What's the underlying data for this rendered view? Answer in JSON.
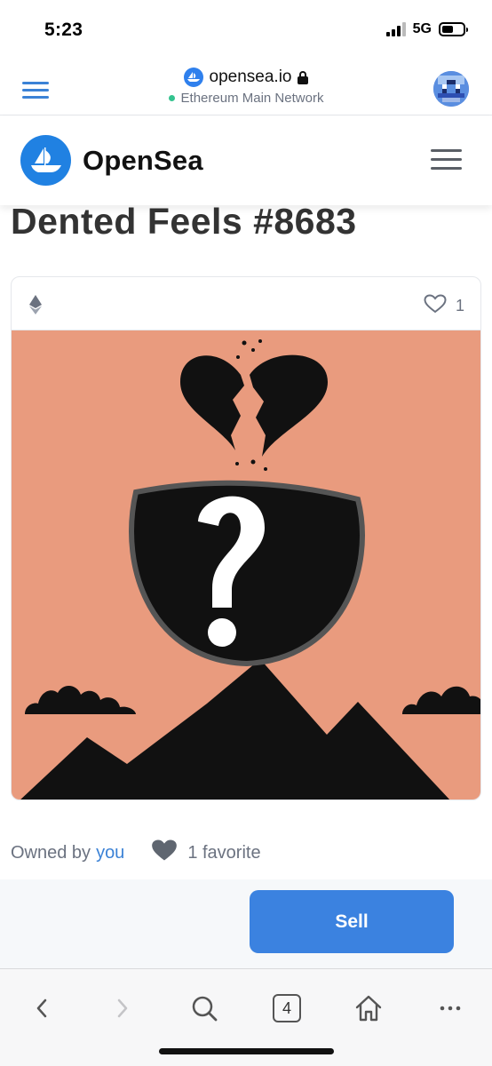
{
  "status": {
    "time": "5:23",
    "network": "5G"
  },
  "browser": {
    "url": "opensea.io",
    "network_label": "Ethereum Main Network"
  },
  "site": {
    "brand": "OpenSea"
  },
  "item": {
    "title": "Dented Feels #8683",
    "favorite_count": "1",
    "owned_by_label": "Owned by",
    "owner": "you",
    "favorites_label": "1 favorite"
  },
  "actions": {
    "sell_label": "Sell"
  },
  "toolbar": {
    "tab_count": "4",
    "icons": [
      "chevron-left-icon",
      "chevron-right-icon",
      "search-icon",
      "tabs-icon",
      "home-icon",
      "more-icon"
    ]
  },
  "colors": {
    "brand_blue": "#2081e2",
    "accent": "#3b82e0",
    "art_background": "#e99b7e"
  }
}
